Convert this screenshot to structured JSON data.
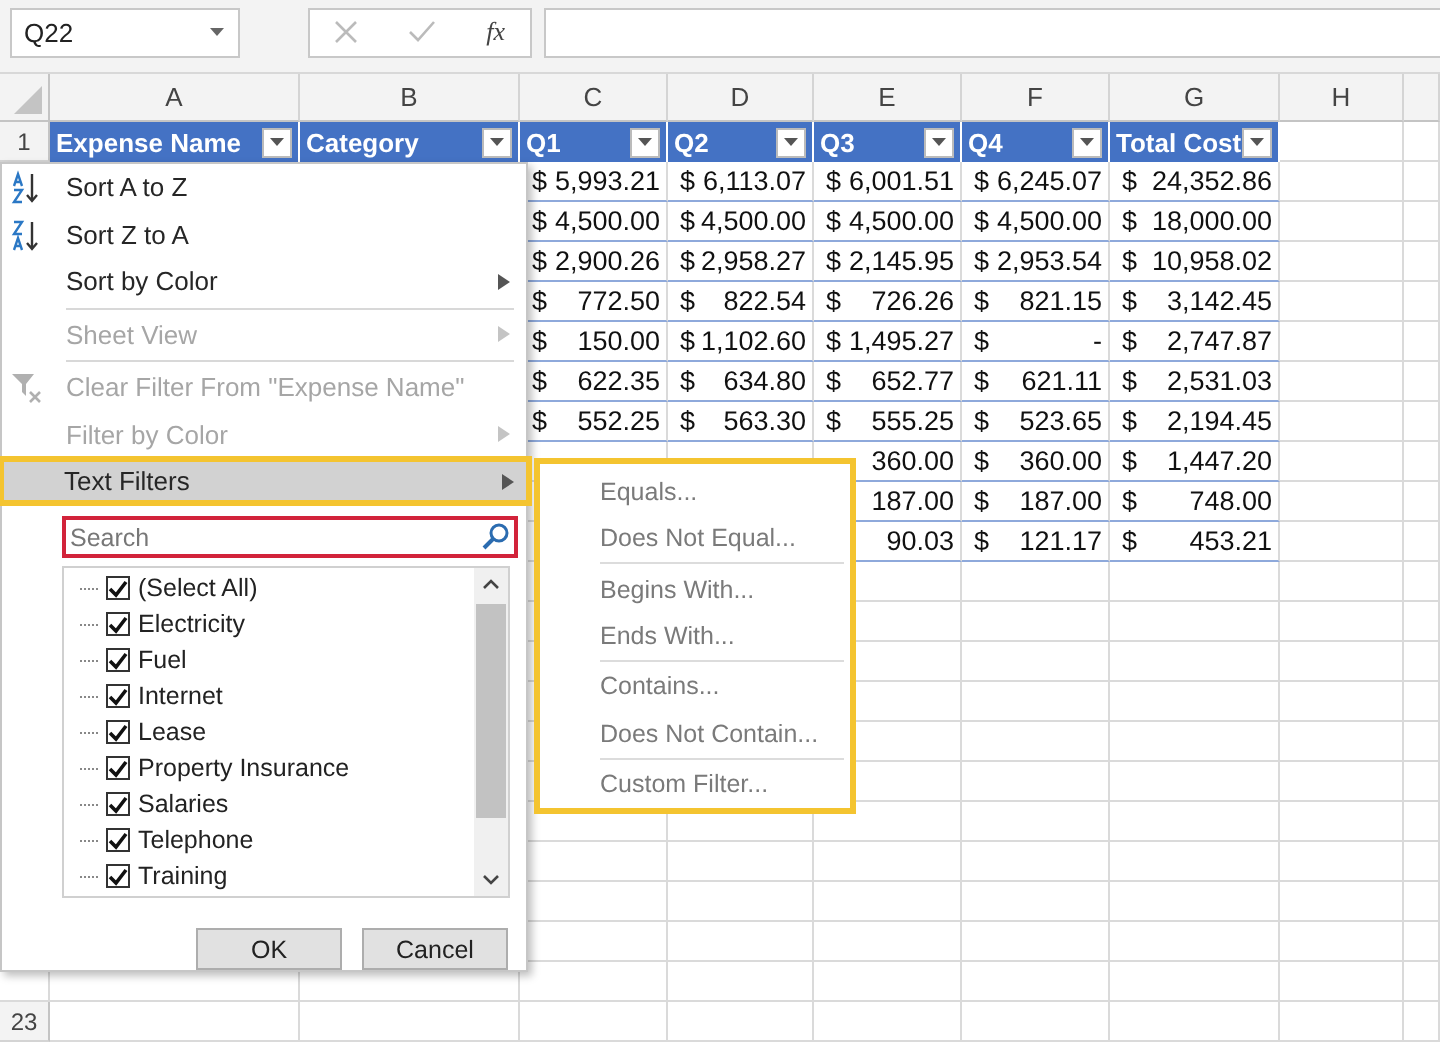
{
  "formula_bar": {
    "name_box": "Q22",
    "formula_icon": "fx"
  },
  "columns": [
    "A",
    "B",
    "C",
    "D",
    "E",
    "F",
    "G",
    "H"
  ],
  "header_row": {
    "number": "1",
    "cells": [
      "Expense Name",
      "Category",
      "Q1",
      "Q2",
      "Q3",
      "Q4",
      "Total Cost"
    ]
  },
  "rows": [
    {
      "q1": {
        "currency": "$",
        "amount": "5,993.21"
      },
      "q2": {
        "currency": "$",
        "amount": "6,113.07"
      },
      "q3": {
        "currency": "$",
        "amount": "6,001.51"
      },
      "q4": {
        "currency": "$",
        "amount": "6,245.07"
      },
      "total": {
        "currency": "$",
        "amount": "24,352.86"
      }
    },
    {
      "q1": {
        "currency": "$",
        "amount": "4,500.00"
      },
      "q2": {
        "currency": "$",
        "amount": "4,500.00"
      },
      "q3": {
        "currency": "$",
        "amount": "4,500.00"
      },
      "q4": {
        "currency": "$",
        "amount": "4,500.00"
      },
      "total": {
        "currency": "$",
        "amount": "18,000.00"
      }
    },
    {
      "q1": {
        "currency": "$",
        "amount": "2,900.26"
      },
      "q2": {
        "currency": "$",
        "amount": "2,958.27"
      },
      "q3": {
        "currency": "$",
        "amount": "2,145.95"
      },
      "q4": {
        "currency": "$",
        "amount": "2,953.54"
      },
      "total": {
        "currency": "$",
        "amount": "10,958.02"
      }
    },
    {
      "q1": {
        "currency": "$",
        "amount": "772.50"
      },
      "q2": {
        "currency": "$",
        "amount": "822.54"
      },
      "q3": {
        "currency": "$",
        "amount": "726.26"
      },
      "q4": {
        "currency": "$",
        "amount": "821.15"
      },
      "total": {
        "currency": "$",
        "amount": "3,142.45"
      }
    },
    {
      "q1": {
        "currency": "$",
        "amount": "150.00"
      },
      "q2": {
        "currency": "$",
        "amount": "1,102.60"
      },
      "q3": {
        "currency": "$",
        "amount": "1,495.27"
      },
      "q4": {
        "currency": "$",
        "amount": "-"
      },
      "total": {
        "currency": "$",
        "amount": "2,747.87"
      }
    },
    {
      "q1": {
        "currency": "$",
        "amount": "622.35"
      },
      "q2": {
        "currency": "$",
        "amount": "634.80"
      },
      "q3": {
        "currency": "$",
        "amount": "652.77"
      },
      "q4": {
        "currency": "$",
        "amount": "621.11"
      },
      "total": {
        "currency": "$",
        "amount": "2,531.03"
      }
    },
    {
      "q1": {
        "currency": "$",
        "amount": "552.25"
      },
      "q2": {
        "currency": "$",
        "amount": "563.30"
      },
      "q3": {
        "currency": "$",
        "amount": "555.25"
      },
      "q4": {
        "currency": "$",
        "amount": "523.65"
      },
      "total": {
        "currency": "$",
        "amount": "2,194.45"
      }
    },
    {
      "q3": {
        "amount": "360.00"
      },
      "q4": {
        "currency": "$",
        "amount": "360.00"
      },
      "total": {
        "currency": "$",
        "amount": "1,447.20"
      }
    },
    {
      "q3": {
        "amount": "187.00"
      },
      "q4": {
        "currency": "$",
        "amount": "187.00"
      },
      "total": {
        "currency": "$",
        "amount": "748.00"
      }
    },
    {
      "q3": {
        "amount": "90.03"
      },
      "q4": {
        "currency": "$",
        "amount": "121.17"
      },
      "total": {
        "currency": "$",
        "amount": "453.21"
      }
    }
  ],
  "last_row_number": "23",
  "filter_menu": {
    "items": [
      {
        "kind": "sort-asc",
        "label": "Sort A to Z",
        "disabled": false,
        "submenu": false,
        "selected": false
      },
      {
        "kind": "sort-desc",
        "label": "Sort Z to A",
        "disabled": false,
        "submenu": false,
        "selected": false
      },
      {
        "kind": "plain",
        "label": "Sort by Color",
        "disabled": false,
        "submenu": true,
        "selected": false
      },
      {
        "kind": "separator"
      },
      {
        "kind": "plain",
        "label": "Sheet View",
        "disabled": true,
        "submenu": true,
        "selected": false
      },
      {
        "kind": "separator"
      },
      {
        "kind": "clear-filter",
        "label": "Clear Filter From \"Expense Name\"",
        "disabled": true,
        "submenu": false,
        "selected": false
      },
      {
        "kind": "plain",
        "label": "Filter by Color",
        "disabled": true,
        "submenu": true,
        "selected": false
      },
      {
        "kind": "plain",
        "label": "Text Filters",
        "disabled": false,
        "submenu": true,
        "selected": true
      }
    ],
    "search": {
      "placeholder": "Search"
    },
    "values": [
      {
        "label": "(Select All)",
        "checked": true
      },
      {
        "label": "Electricity",
        "checked": true
      },
      {
        "label": "Fuel",
        "checked": true
      },
      {
        "label": "Internet",
        "checked": true
      },
      {
        "label": "Lease",
        "checked": true
      },
      {
        "label": "Property Insurance",
        "checked": true
      },
      {
        "label": "Salaries",
        "checked": true
      },
      {
        "label": "Telephone",
        "checked": true
      },
      {
        "label": "Training",
        "checked": true
      }
    ],
    "buttons": [
      "OK",
      "Cancel"
    ]
  },
  "text_filters_menu": {
    "items": [
      {
        "kind": "item",
        "label": "Equals..."
      },
      {
        "kind": "item",
        "label": "Does Not Equal..."
      },
      {
        "kind": "separator"
      },
      {
        "kind": "item",
        "label": "Begins With..."
      },
      {
        "kind": "item",
        "label": "Ends With..."
      },
      {
        "kind": "separator"
      },
      {
        "kind": "item",
        "label": "Contains..."
      },
      {
        "kind": "item",
        "label": "Does Not Contain..."
      },
      {
        "kind": "separator"
      },
      {
        "kind": "item",
        "label": "Custom Filter..."
      }
    ]
  }
}
